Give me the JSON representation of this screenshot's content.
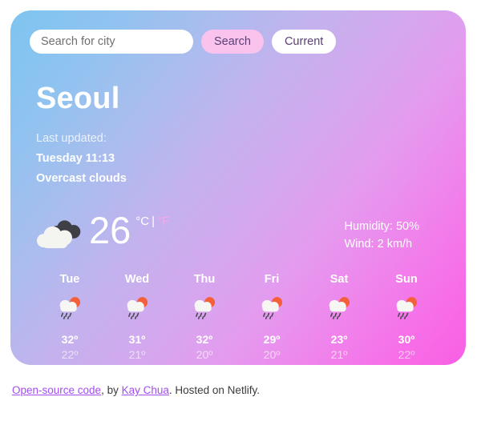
{
  "search": {
    "placeholder": "Search for city",
    "value": "",
    "search_label": "Search",
    "current_label": "Current"
  },
  "current": {
    "city": "Seoul",
    "last_updated_label": "Last updated:",
    "updated_time": "Tuesday 11:13",
    "description": "Overcast clouds",
    "temperature": "26",
    "unit_celsius": "°C",
    "unit_separator": "|",
    "unit_fahrenheit": "°F",
    "icon": "cloud-icon",
    "humidity": "Humidity: 50%",
    "wind": "Wind: 2 km/h"
  },
  "forecast": [
    {
      "day": "Tue",
      "icon": "sun-behind-rain-cloud-icon",
      "high": "32º",
      "low": "22º"
    },
    {
      "day": "Wed",
      "icon": "sun-behind-rain-cloud-icon",
      "high": "31º",
      "low": "21º"
    },
    {
      "day": "Thu",
      "icon": "sun-behind-rain-cloud-icon",
      "high": "32º",
      "low": "20º"
    },
    {
      "day": "Fri",
      "icon": "sun-behind-rain-cloud-icon",
      "high": "29º",
      "low": "20º"
    },
    {
      "day": "Sat",
      "icon": "sun-behind-rain-cloud-icon",
      "high": "23º",
      "low": "21º"
    },
    {
      "day": "Sun",
      "icon": "sun-behind-rain-cloud-icon",
      "high": "30º",
      "low": "22º"
    }
  ],
  "footer": {
    "source_link": "Open-source code",
    "by_text": ", by ",
    "author_link": "Kay Chua",
    "host_text": ". Hosted on Netlify."
  },
  "colors": {
    "gradient_start": "#7ec4f0",
    "gradient_end": "#f95fe3",
    "search_button_bg": "#f9c3ee",
    "button_text": "#5b3f74",
    "unit_inactive": "#fba6e6",
    "link": "#a24df0"
  }
}
